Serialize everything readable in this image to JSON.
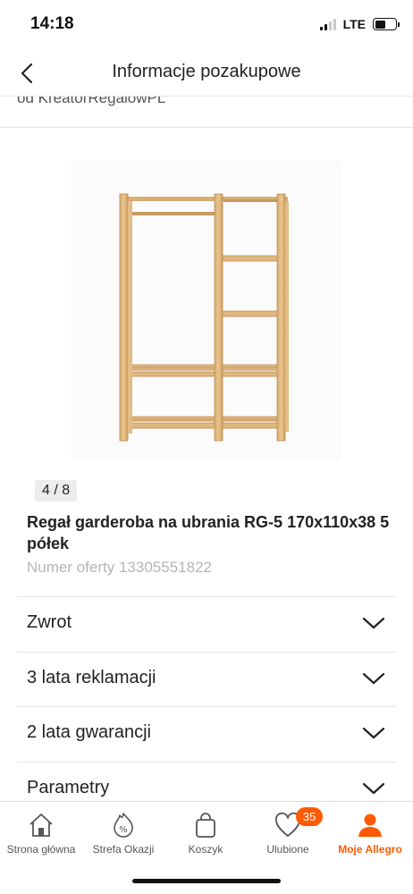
{
  "status_bar": {
    "time": "14:18",
    "network": "LTE",
    "signal_bars": 2,
    "battery_level": 0.5
  },
  "nav": {
    "title": "Informacje pozakupowe",
    "back_icon": "chevron-left-icon"
  },
  "seller": {
    "text": "od KreatorRegalowPL"
  },
  "gallery": {
    "counter": "4 / 8",
    "current": 4,
    "total": 8
  },
  "product": {
    "title": "Regał garderoba na ubrania RG-5 170x110x38 5 półek",
    "offer_number": "Numer oferty 13305551822"
  },
  "sections": [
    {
      "label": "Zwrot"
    },
    {
      "label": "3 lata reklamacji"
    },
    {
      "label": "2 lata gwarancji"
    },
    {
      "label": "Parametry"
    }
  ],
  "tab_bar": {
    "tabs": [
      {
        "label": "Strona główna",
        "icon": "home-icon"
      },
      {
        "label": "Strefa Okazji",
        "icon": "discount-icon"
      },
      {
        "label": "Koszyk",
        "icon": "cart-icon"
      },
      {
        "label": "Ulubione",
        "icon": "heart-icon",
        "badge": "35"
      },
      {
        "label": "Moje Allegro",
        "icon": "user-icon",
        "active": true
      }
    ]
  },
  "colors": {
    "accent": "#ff5a00",
    "text": "#222222",
    "muted": "#b5b5b5",
    "wood": "#dcb37a"
  }
}
